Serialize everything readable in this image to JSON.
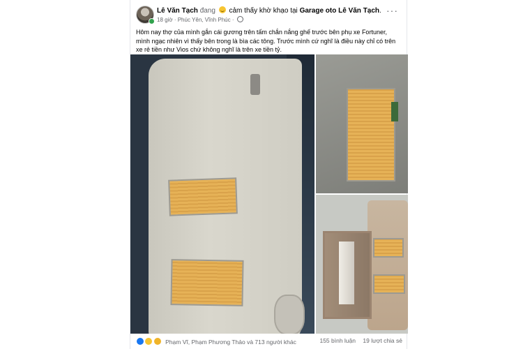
{
  "post": {
    "author": "Lê Văn Tạch",
    "status_prefix": "đang",
    "feeling": "cảm thấy khờ khạo tại",
    "place": "Garage oto Lê Văn Tạch",
    "place_suffix": ".",
    "time": "18 giờ",
    "location": "· Phúc Yên, Vĩnh Phúc ·",
    "text": "Hôm nay thợ của mình gắn cái gương trên tấm chắn nắng ghế trước bên phụ xe Fortuner, mình ngạc nhiên vì thấy bên trong là bìa các tông. Trước mình cứ nghĩ là điều này chỉ có trên xe rẻ tiền như Vios chứ không nghĩ là trên xe tiền tỷ.",
    "reactions_text": "Phạm Vĩ, Phạm Phương Thảo và 713 người khác",
    "comments": "155 bình luận",
    "shares": "19 lượt chia sẻ"
  },
  "icons": {
    "more": "more-icon",
    "privacy": "globe-icon",
    "reactions": [
      "like-icon",
      "haha-icon",
      "wow-icon"
    ]
  },
  "colors": {
    "muted": "#65676b",
    "like": "#1877f2",
    "online": "#31a24c"
  }
}
